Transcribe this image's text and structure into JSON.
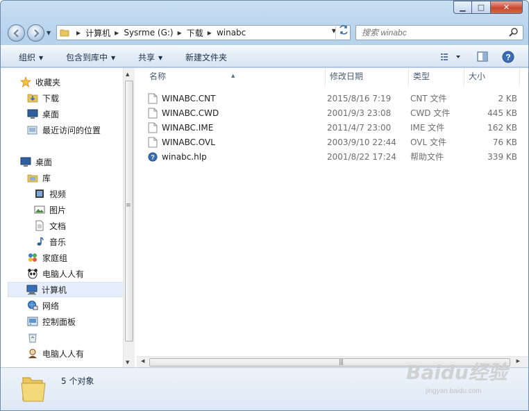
{
  "window": {
    "min_label": "▁",
    "max_label": "□",
    "close_label": "✕"
  },
  "address": {
    "crumbs": [
      "计算机",
      "Sysrme (G:)",
      "下载",
      "winabc"
    ]
  },
  "search": {
    "placeholder": "搜索 winabc"
  },
  "toolbar": {
    "organize": "组织",
    "include_in_library": "包含到库中",
    "share": "共享",
    "new_folder": "新建文件夹"
  },
  "nav": {
    "favorites": "收藏夹",
    "downloads": "下载",
    "desktop_fav": "桌面",
    "recent": "最近访问的位置",
    "desktop": "桌面",
    "libraries": "库",
    "videos": "视频",
    "pictures": "图片",
    "documents": "文档",
    "music": "音乐",
    "homegroup": "家庭组",
    "user1": "电脑人人有",
    "computer": "计算机",
    "network": "网络",
    "control_panel": "控制面板",
    "user2": "电脑人人有"
  },
  "columns": {
    "name": "名称",
    "date": "修改日期",
    "type": "类型",
    "size": "大小"
  },
  "files": [
    {
      "name": "WINABC.CNT",
      "date": "2015/8/16 7:19",
      "type": "CNT 文件",
      "size": "2 KB",
      "icon": "file-icon"
    },
    {
      "name": "WINABC.CWD",
      "date": "2001/9/3 23:08",
      "type": "CWD 文件",
      "size": "445 KB",
      "icon": "file-icon"
    },
    {
      "name": "WINABC.IME",
      "date": "2011/4/7 23:00",
      "type": "IME 文件",
      "size": "162 KB",
      "icon": "file-icon"
    },
    {
      "name": "WINABC.OVL",
      "date": "2003/9/10 22:44",
      "type": "OVL 文件",
      "size": "76 KB",
      "icon": "file-icon"
    },
    {
      "name": "winabc.hlp",
      "date": "2001/8/22 17:24",
      "type": "帮助文件",
      "size": "339 KB",
      "icon": "help-file-icon"
    }
  ],
  "status": {
    "count": "5 个对象"
  },
  "watermark": {
    "brand": "Baidu经验",
    "url": "jingyan.baidu.com"
  }
}
